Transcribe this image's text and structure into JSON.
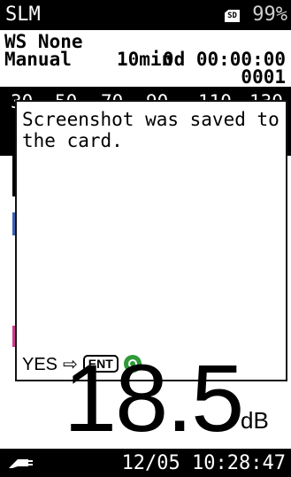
{
  "header": {
    "mode": "SLM",
    "sd_icon": "sd-card-icon",
    "sd_label": "SD",
    "battery": "99%"
  },
  "info": {
    "weighting_summary": "WS None",
    "measure_mode": "Manual",
    "interval": "10min",
    "elapsed": "0d 00:00:00",
    "store_number": "0001"
  },
  "scale": {
    "ticks": [
      "30",
      "50",
      "70",
      "90",
      "110",
      "130"
    ]
  },
  "dialog": {
    "message": "Screenshot was saved to the card.",
    "yes_label": "YES",
    "arrow": "⇨",
    "key_label": "ENT",
    "ok_icon": "ok-circle-icon"
  },
  "reading": {
    "value": "18.5",
    "unit": "dB"
  },
  "status": {
    "power_icon": "ac-plug-icon",
    "datetime": "12/05 10:28:47"
  },
  "colors": {
    "accent_blue": "#3a63b3",
    "accent_pink": "#d03a8e",
    "ok_green": "#2f9a3a"
  }
}
